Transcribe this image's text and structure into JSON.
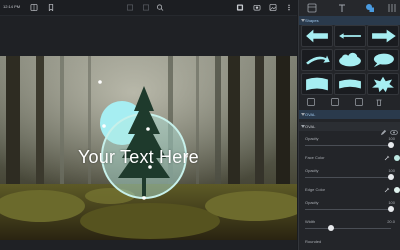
{
  "status": {
    "time": "12:14 PM"
  },
  "canvas": {
    "overlay_text": "Your Text Here",
    "circle_color": "#a6eef2",
    "ring_color": "#b2e8e0"
  },
  "panel": {
    "shapes_section": "Shapes",
    "oval_section": "OVAL",
    "oval_subsection": "OVAL",
    "props": {
      "opacity_1_label": "Opacity",
      "opacity_1_value": "100",
      "opacity_1_level": 1.0,
      "face_color_label": "Face Color",
      "face_color": "#bfe9e3",
      "opacity_2_label": "Opacity",
      "opacity_2_value": "100",
      "opacity_2_level": 1.0,
      "edge_color_label": "Edge Color",
      "edge_color": "#e0f3ef",
      "opacity_3_label": "Opacity",
      "opacity_3_value": "100",
      "opacity_3_level": 1.0,
      "width_label": "Width",
      "width_value": "20.0",
      "width_level": 0.3,
      "rounded_label": "Rounded"
    }
  },
  "colors": {
    "accent": "#4a9be0",
    "shape_fill": "#a6eef2"
  },
  "icons": {
    "toolbar": [
      "grid-icon",
      "bookmark-icon",
      "crop-icon",
      "layers-icon",
      "hand-icon",
      "zoom-icon",
      "share-icon",
      "camera-icon",
      "image-icon",
      "more-icon"
    ],
    "tabs": [
      "layout-icon",
      "text-icon",
      "shapes-icon",
      "sliders-icon"
    ]
  }
}
